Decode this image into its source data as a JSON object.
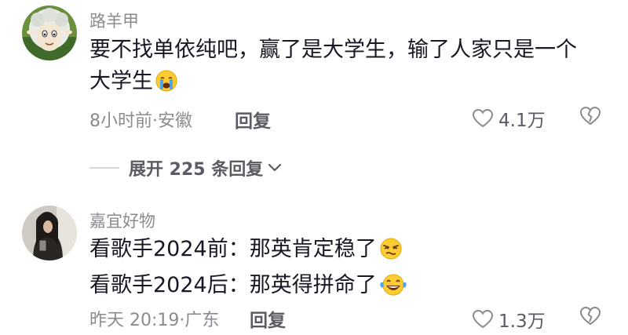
{
  "comments": [
    {
      "username": "路羊甲",
      "lines": [
        "要不找单依纯吧，赢了是大学生，输了人家只是一个",
        "大学生"
      ],
      "time_location": "8小时前·安徽",
      "reply_label": "回复",
      "likes": "4.1万",
      "avatar_icon": "cartoon-sheep-avatar",
      "emoji_icon": "crying-face-emoji"
    },
    {
      "username": "嘉宜好物",
      "lines": [
        "看歌手2024前：那英肯定稳了",
        "看歌手2024后：那英得拼命了"
      ],
      "time_location": "昨天 20:19·广东",
      "reply_label": "回复",
      "likes": "1.3万",
      "avatar_icon": "person-photo-avatar",
      "emoji_icons": [
        "smirk-face-emoji",
        "tears-of-joy-emoji"
      ]
    }
  ],
  "expand_replies": {
    "label": "展开 225 条回复"
  },
  "colors": {
    "primary_text": "#161823",
    "secondary_text": "#8a8b91",
    "action_text": "#5b5c63"
  }
}
